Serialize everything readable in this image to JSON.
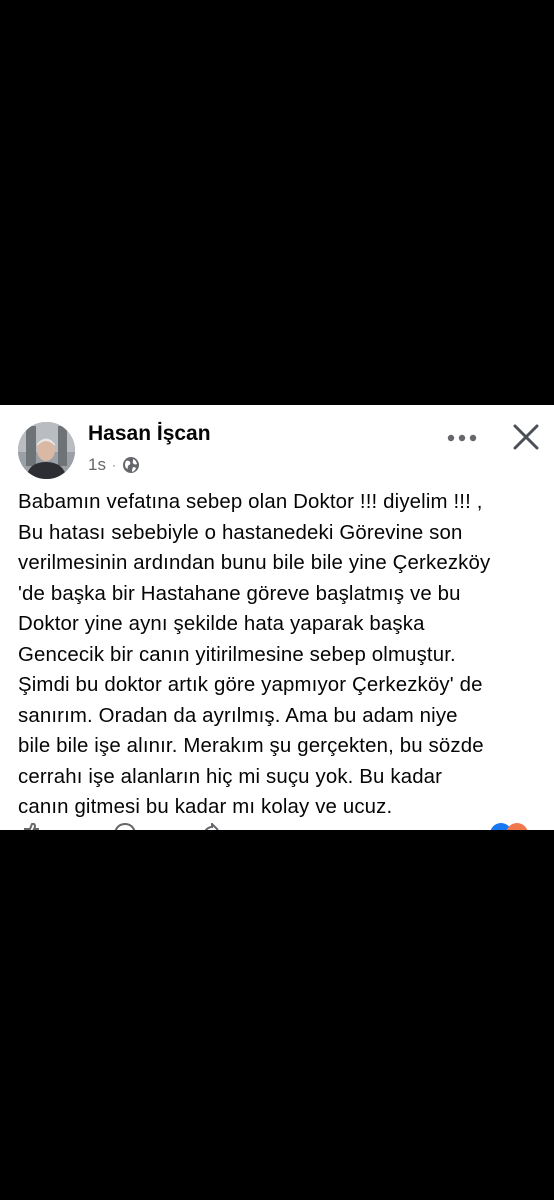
{
  "post": {
    "author_name": "Hasan İşcan",
    "timestamp": "1s",
    "meta_separator": "·",
    "privacy_icon": "globe-icon",
    "more_icon": "more-options-icon",
    "close_icon": "close-icon",
    "text": "Babamın vefatına sebep olan Doktor !!! diyelim !!! ,\nBu hatası sebebiyle o hastanedeki Görevine son\nverilmesinin ardından bunu bile bile yine Çerkezköy\n'de başka bir Hastahane göreve başlatmış ve bu\nDoktor yine aynı şekilde hata yaparak başka\nGencecik bir canın yitirilmesine sebep olmuştur.\nŞimdi bu doktor artık göre yapmıyor Çerkezköy' de\nsanırım. Oradan da ayrılmış. Ama bu adam niye\nbile bile işe alınır. Merakım şu gerçekten, bu sözde\ncerrahı işe alanların hiç mi suçu yok. Bu kadar\ncanın gitmesi bu kadar mı kolay ve ucuz.",
    "actions": [
      {
        "icon": "like-icon"
      },
      {
        "icon": "comment-icon"
      },
      {
        "icon": "share-icon"
      }
    ],
    "reactions": [
      {
        "icon": "like-reaction-icon",
        "color": "#1877f2"
      },
      {
        "icon": "love-reaction-icon",
        "color": "#f0784a"
      }
    ]
  },
  "colors": {
    "background": "#000000",
    "card": "#ffffff",
    "text_primary": "#050505",
    "text_secondary": "#65676b"
  }
}
